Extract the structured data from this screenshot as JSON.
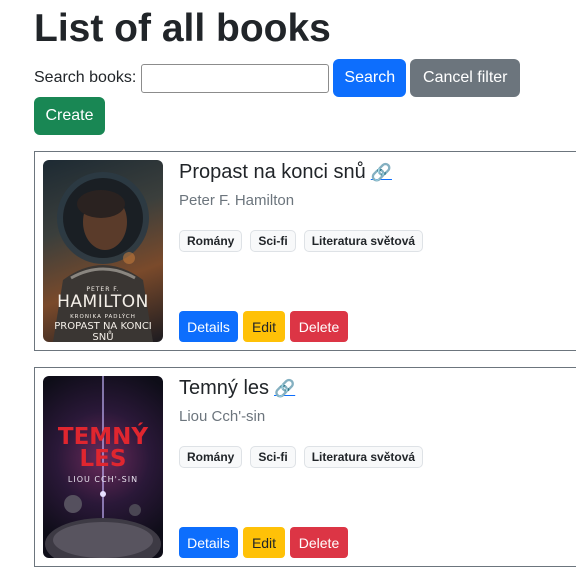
{
  "page": {
    "title": "List of all books"
  },
  "search": {
    "label": "Search books:",
    "value": "",
    "placeholder": "",
    "search_button": "Search",
    "cancel_button": "Cancel filter"
  },
  "create_button": "Create",
  "books": [
    {
      "title": "Propast na konci snů",
      "link_icon": "link-icon",
      "link_glyph": "🔗",
      "author": "Peter F. Hamilton",
      "tags": [
        "Romány",
        "Sci-fi",
        "Literatura světová"
      ],
      "cover": {
        "author_small": "PETER F.",
        "author": "HAMILTON",
        "series": "KRONIKA PADLÝCH",
        "title": "PROPAST NA KONCI SNŮ"
      },
      "actions": {
        "details": "Details",
        "edit": "Edit",
        "delete": "Delete"
      }
    },
    {
      "title": "Temný les",
      "link_icon": "link-icon",
      "link_glyph": "🔗",
      "author": "Liou Cch'-sin",
      "tags": [
        "Romány",
        "Sci-fi",
        "Literatura světová"
      ],
      "cover": {
        "title": "TEMNÝ LES",
        "author": "LIOU CCH'-SIN"
      },
      "actions": {
        "details": "Details",
        "edit": "Edit",
        "delete": "Delete"
      }
    }
  ],
  "colors": {
    "primary": "#0d6efd",
    "secondary": "#6c757d",
    "success": "#198754",
    "warning": "#ffc107",
    "danger": "#dc3545"
  }
}
